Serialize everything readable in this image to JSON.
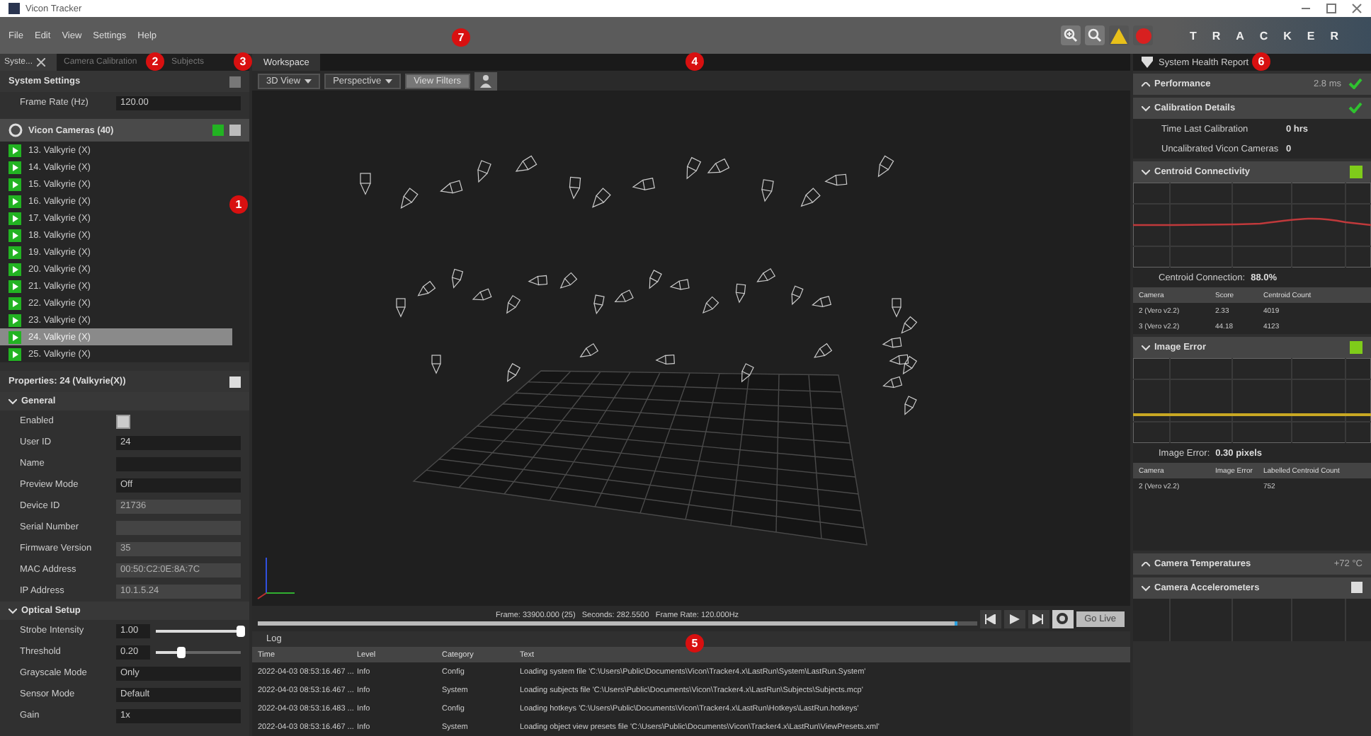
{
  "window": {
    "title": "Vicon Tracker"
  },
  "menu": [
    "File",
    "Edit",
    "View",
    "Settings",
    "Help"
  ],
  "toolbar_icons": [
    {
      "kind": "zoom-in"
    },
    {
      "kind": "zoom-out"
    },
    {
      "kind": "warning"
    },
    {
      "kind": "error"
    }
  ],
  "logo": "TRACKER",
  "left_tabs": [
    {
      "label": "Syste...",
      "selected": true,
      "closable": true
    },
    {
      "label": "Camera Calibration",
      "selected": false,
      "closable": false
    },
    {
      "label": "Subjects",
      "selected": false,
      "closable": false
    }
  ],
  "system_settings": {
    "title": "System Settings",
    "rows": [
      {
        "label": "Frame Rate (Hz)",
        "value": "120.00"
      }
    ]
  },
  "cameras": {
    "title": "Vicon Cameras (40)",
    "items": [
      {
        "label": "13. Valkyrie (X)",
        "enabled": true,
        "selected": false
      },
      {
        "label": "14. Valkyrie (X)",
        "enabled": true,
        "selected": false
      },
      {
        "label": "15. Valkyrie (X)",
        "enabled": true,
        "selected": false
      },
      {
        "label": "16. Valkyrie (X)",
        "enabled": true,
        "selected": false
      },
      {
        "label": "17. Valkyrie (X)",
        "enabled": true,
        "selected": false
      },
      {
        "label": "18. Valkyrie (X)",
        "enabled": true,
        "selected": false
      },
      {
        "label": "19. Valkyrie (X)",
        "enabled": true,
        "selected": false
      },
      {
        "label": "20. Valkyrie (X)",
        "enabled": true,
        "selected": false
      },
      {
        "label": "21. Valkyrie (X)",
        "enabled": true,
        "selected": false
      },
      {
        "label": "22. Valkyrie (X)",
        "enabled": true,
        "selected": false
      },
      {
        "label": "23. Valkyrie (X)",
        "enabled": true,
        "selected": false
      },
      {
        "label": "24. Valkyrie (X)",
        "enabled": true,
        "selected": true
      },
      {
        "label": "25. Valkyrie (X)",
        "enabled": true,
        "selected": false
      }
    ]
  },
  "properties": {
    "title": "Properties: 24 (Valkyrie(X))",
    "sections": [
      {
        "title": "General",
        "expanded": true,
        "rows": [
          {
            "kind": "checkbox",
            "label": "Enabled",
            "checked": true
          },
          {
            "kind": "text",
            "label": "User ID",
            "value": "24"
          },
          {
            "kind": "empty",
            "label": "Name"
          },
          {
            "kind": "text",
            "label": "Preview Mode",
            "value": "Off"
          },
          {
            "kind": "readonly",
            "label": "Device ID",
            "value": "21736"
          },
          {
            "kind": "blank",
            "label": "Serial Number"
          },
          {
            "kind": "readonly",
            "label": "Firmware Version",
            "value": "35"
          },
          {
            "kind": "readonly",
            "label": "MAC Address",
            "value": "00:50:C2:0E:8A:7C"
          },
          {
            "kind": "readonly",
            "label": "IP Address",
            "value": "10.1.5.24"
          }
        ]
      },
      {
        "title": "Optical Setup",
        "expanded": true,
        "rows": [
          {
            "kind": "slider",
            "label": "Strobe Intensity",
            "value": "1.00",
            "level": 1
          },
          {
            "kind": "slider",
            "label": "Threshold",
            "value": "0.20",
            "level": 0.3
          },
          {
            "kind": "text",
            "label": "Grayscale Mode",
            "value": "Only"
          },
          {
            "kind": "dropdown",
            "label": "Sensor Mode",
            "value": "Default"
          },
          {
            "kind": "dropdown",
            "label": "Gain",
            "value": "1x"
          }
        ]
      }
    ]
  },
  "workspace": {
    "tab": "Workspace",
    "view": "3D View",
    "projection": "Perspective",
    "filters": "View Filters"
  },
  "timeline": {
    "info": "Frame: 33900.000 (25)   Seconds: 282.5500   Frame Rate: 120.000Hz",
    "level": 0.97,
    "action": "Go Live"
  },
  "log": {
    "title": "Log",
    "columns": [
      "Time",
      "Level",
      "Category",
      "Text"
    ],
    "rows": [
      {
        "time": "2022-04-03 08:53:16.467 ...",
        "level": "Info",
        "category": "Config",
        "text": "Loading system file 'C:\\Users\\Public\\Documents\\Vicon\\Tracker4.x\\LastRun\\System\\LastRun.System'"
      },
      {
        "time": "2022-04-03 08:53:16.467 ...",
        "level": "Info",
        "category": "System",
        "text": "Loading subjects file 'C:\\Users\\Public\\Documents\\Vicon\\Tracker4.x\\LastRun\\Subjects\\Subjects.mcp'"
      },
      {
        "time": "2022-04-03 08:53:16.483 ...",
        "level": "Info",
        "category": "Config",
        "text": "Loading hotkeys 'C:\\Users\\Public\\Documents\\Vicon\\Tracker4.x\\LastRun\\Hotkeys\\LastRun.hotkeys'"
      },
      {
        "time": "2022-04-03 08:53:16.467 ...",
        "level": "Info",
        "category": "System",
        "text": "Loading object view presets file 'C:\\Users\\Public\\Documents\\Vicon\\Tracker4.x\\LastRun\\ViewPresets.xml'"
      }
    ]
  },
  "health": {
    "title": "System Health Report",
    "sections": [
      {
        "kind": "status",
        "title": "Performance",
        "expanded": false,
        "value": "2.8 ms",
        "ok": true
      },
      {
        "kind": "details",
        "title": "Calibration Details",
        "expanded": true,
        "ok": true,
        "rows": [
          {
            "label": "Time Last Calibration",
            "value": "0 hrs"
          },
          {
            "label": "Uncalibrated Vicon Cameras",
            "value": "0"
          }
        ]
      },
      {
        "kind": "chart",
        "title": "Centroid Connectivity",
        "expanded": true,
        "color": "#c0393b",
        "stat_label": "Centroid Connection:",
        "stat_value": "88.0%",
        "columns": [
          "Camera",
          "Score",
          "Centroid Count"
        ],
        "rows": [
          [
            "2 (Vero v2.2)",
            "2.33",
            "4019"
          ],
          [
            "3 (Vero v2.2)",
            "44.18",
            "4123"
          ]
        ]
      },
      {
        "kind": "chart",
        "title": "Image Error",
        "expanded": true,
        "color": "#c9a823",
        "stat_label": "Image Error:",
        "stat_value": "0.30 pixels",
        "columns": [
          "Camera",
          "Image Error",
          "Labelled Centroid Count"
        ],
        "rows": [
          [
            "2 (Vero v2.2)",
            "",
            "752"
          ]
        ]
      },
      {
        "kind": "status",
        "title": "Camera Temperatures",
        "expanded": false,
        "value": "+72 °C",
        "ok": false
      },
      {
        "kind": "toggle",
        "title": "Camera Accelerometers",
        "expanded": true
      }
    ]
  },
  "callouts": [
    "1",
    "2",
    "3",
    "4",
    "5",
    "6",
    "7"
  ]
}
